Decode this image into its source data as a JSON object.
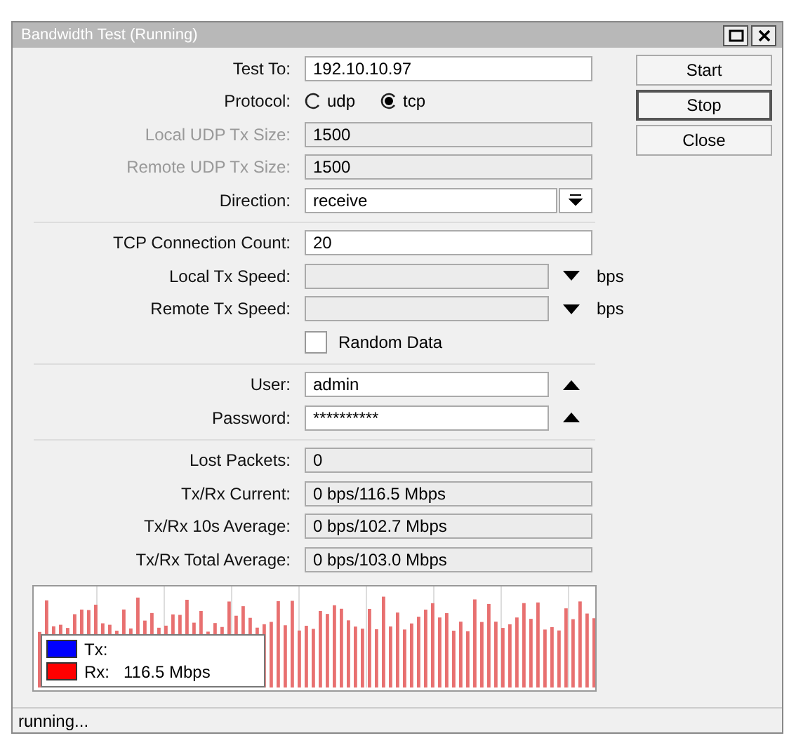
{
  "window": {
    "title": "Bandwidth Test (Running)"
  },
  "fields": [
    {
      "kind": "text",
      "label": "Test To:",
      "value": "192.10.10.97",
      "disabled": false
    },
    {
      "kind": "radio",
      "label": "Protocol:",
      "options": [
        {
          "label": "udp",
          "selected": false
        },
        {
          "label": "tcp",
          "selected": true
        }
      ]
    },
    {
      "kind": "readonly",
      "label": "Local UDP Tx Size:",
      "value": "1500",
      "disabled": true
    },
    {
      "kind": "readonly",
      "label": "Remote UDP Tx Size:",
      "value": "1500",
      "disabled": true
    },
    {
      "kind": "dropdown",
      "label": "Direction:",
      "value": "receive"
    },
    {
      "kind": "separator"
    },
    {
      "kind": "text",
      "label": "TCP Connection Count:",
      "value": "20",
      "disabled": false
    },
    {
      "kind": "speed",
      "label": "Local Tx Speed:",
      "unit": "bps"
    },
    {
      "kind": "speed",
      "label": "Remote Tx Speed:",
      "unit": "bps"
    },
    {
      "kind": "checkbox",
      "label": "Random Data",
      "checked": false
    },
    {
      "kind": "separator"
    },
    {
      "kind": "collapsible",
      "label": "User:",
      "value": "admin"
    },
    {
      "kind": "collapsible",
      "label": "Password:",
      "value": "**********"
    },
    {
      "kind": "separator"
    },
    {
      "kind": "readonly",
      "label": "Lost Packets:",
      "value": "0",
      "disabled": false
    },
    {
      "kind": "readonly",
      "label": "Tx/Rx Current:",
      "value": "0 bps/116.5 Mbps",
      "disabled": false
    },
    {
      "kind": "readonly",
      "label": "Tx/Rx 10s Average:",
      "value": "0 bps/102.7 Mbps",
      "disabled": false
    },
    {
      "kind": "readonly",
      "label": "Tx/Rx Total Average:",
      "value": "0 bps/103.0 Mbps",
      "disabled": false
    }
  ],
  "buttons": [
    {
      "label": "Start",
      "selected": false
    },
    {
      "label": "Stop",
      "selected": true
    },
    {
      "label": "Close",
      "selected": false
    }
  ],
  "legend": [
    {
      "label": "Tx:",
      "color": "#0000ff"
    },
    {
      "label": "Rx:",
      "value": "116.5 Mbps",
      "color": "#ff0000"
    }
  ],
  "status_bar": "running..."
}
